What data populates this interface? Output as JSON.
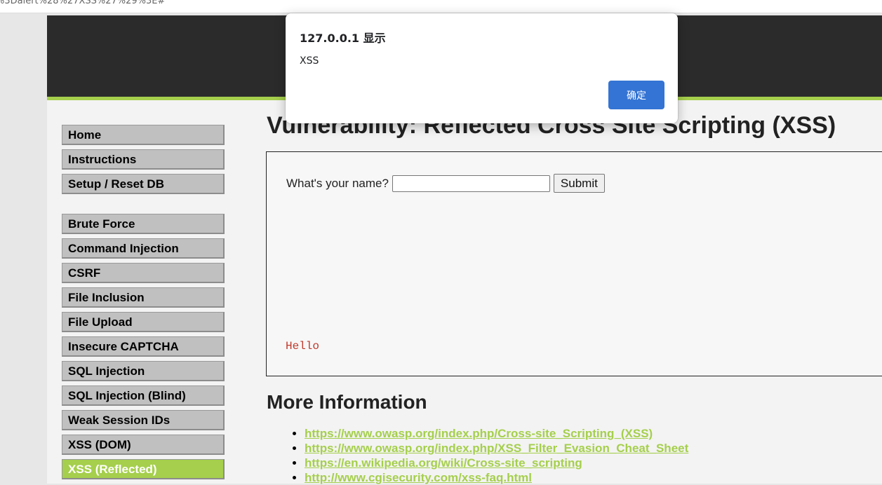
{
  "browser": {
    "url": "%3Dalert%28%27XSS%27%29%3E#"
  },
  "sidebar": {
    "group1": [
      "Home",
      "Instructions",
      "Setup / Reset DB"
    ],
    "group2": [
      "Brute Force",
      "Command Injection",
      "CSRF",
      "File Inclusion",
      "File Upload",
      "Insecure CAPTCHA",
      "SQL Injection",
      "SQL Injection (Blind)",
      "Weak Session IDs",
      "XSS (DOM)",
      "XSS (Reflected)"
    ],
    "active": "XSS (Reflected)"
  },
  "main": {
    "title": "Vulnerability: Reflected Cross Site Scripting (XSS)",
    "form": {
      "label": "What's your name?",
      "input_value": "",
      "submit_label": "Submit"
    },
    "output": "Hello",
    "more_info_title": "More Information",
    "links": [
      "https://www.owasp.org/index.php/Cross-site_Scripting_(XSS)",
      "https://www.owasp.org/index.php/XSS_Filter_Evasion_Cheat_Sheet",
      "https://en.wikipedia.org/wiki/Cross-site_scripting",
      "http://www.cgisecurity.com/xss-faq.html"
    ]
  },
  "alert": {
    "title": "127.0.0.1 显示",
    "message": "XSS",
    "ok_label": "确定"
  },
  "colors": {
    "accent": "#a5cf4c",
    "header": "#2b2b2b",
    "dialog_button": "#3474d4"
  }
}
